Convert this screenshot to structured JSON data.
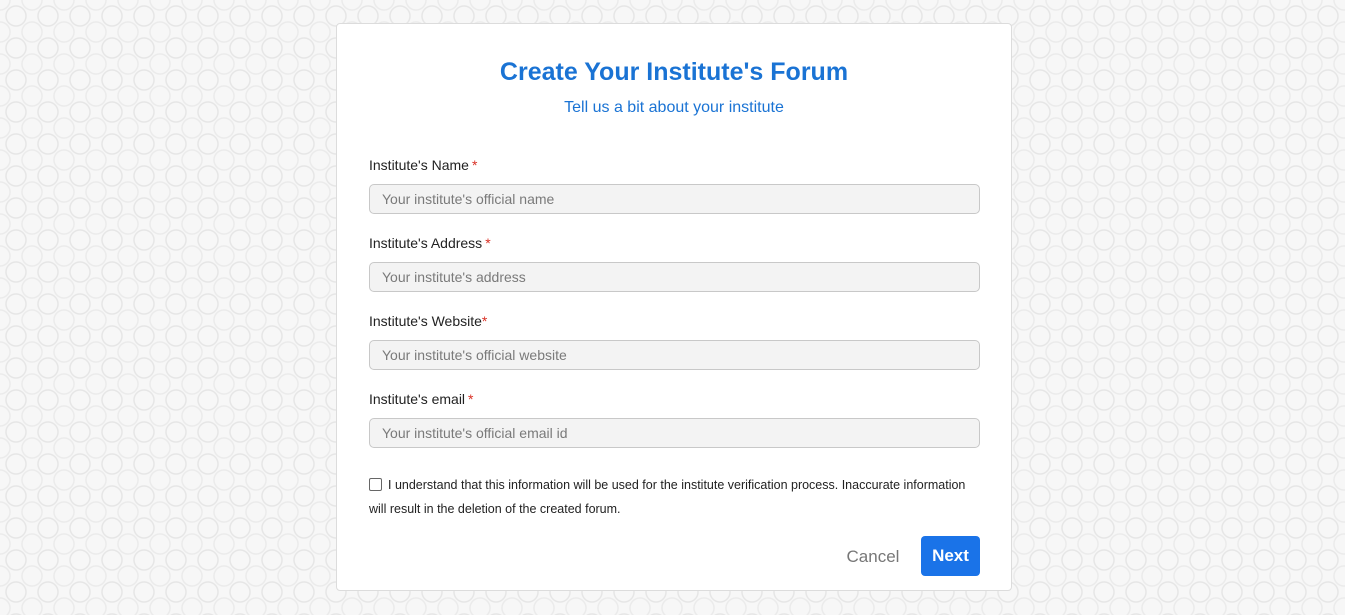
{
  "form": {
    "title": "Create Your Institute's Forum",
    "subtitle": "Tell us a bit about your institute",
    "fields": [
      {
        "label": "Institute's Name",
        "required_mark": "*",
        "value": "",
        "placeholder": "Your institute's official name"
      },
      {
        "label": "Institute's Address",
        "required_mark": "*",
        "value": "",
        "placeholder": "Your institute's address"
      },
      {
        "label": "Institute's Website",
        "required_mark": "*",
        "value": "",
        "placeholder": "Your institute's official website"
      },
      {
        "label": "Institute's email",
        "required_mark": "*",
        "value": "",
        "placeholder": "Your institute's official email id"
      }
    ],
    "consent": {
      "checked": false,
      "text": "I understand that this information will be used for the institute verification process. Inaccurate information will result in the deletion of the created forum."
    },
    "actions": {
      "cancel_label": "Cancel",
      "next_label": "Next"
    }
  },
  "colors": {
    "accent": "#1a73e8",
    "title": "#1a73d4",
    "required": "#d93025"
  }
}
